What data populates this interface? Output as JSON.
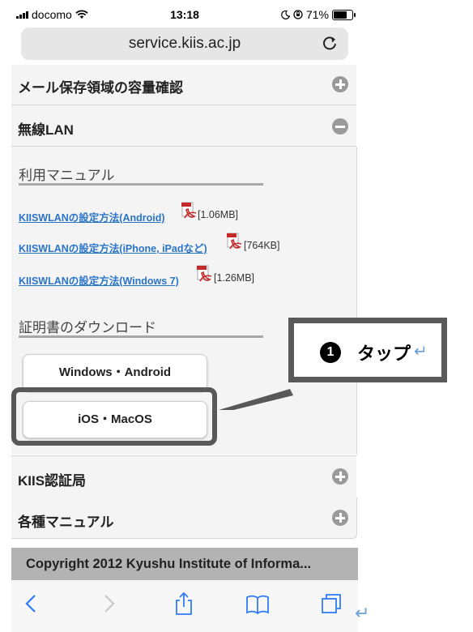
{
  "status_bar": {
    "carrier": "docomo",
    "time": "13:18",
    "battery": "71%"
  },
  "browser": {
    "url": "service.kiis.ac.jp"
  },
  "accordion": {
    "storage": "メール保存領域の容量確認",
    "wireless": "無線LAN",
    "ca": "KIIS認証局",
    "manuals": "各種マニュアル"
  },
  "wlan": {
    "manual_title": "利用マニュアル",
    "files": [
      {
        "label": "KIISWLANの設定方法(Android)",
        "size": "[1.06MB]"
      },
      {
        "label": "KIISWLANの設定方法(iPhone, iPadなど)",
        "size": "[764KB]"
      },
      {
        "label": "KIISWLANの設定方法(Windows 7)",
        "size": "[1.26MB]"
      }
    ],
    "cert_title": "証明書のダウンロード",
    "btn_windows": "Windows・Android",
    "btn_ios": "iOS・MacOS"
  },
  "footer": {
    "copyright": "Copyright 2012 Kyushu Institute of Informa..."
  },
  "callout": {
    "number": "1",
    "text": "タップ",
    "return_mark": "↵"
  },
  "colors": {
    "link": "#2a74c8",
    "callout_border": "#585858",
    "return_mark": "#6aa0d8"
  },
  "icons": [
    "signal-bars-icon",
    "wifi-icon",
    "moon-icon",
    "rotation-lock-icon",
    "battery-icon",
    "reload-icon",
    "plus-circle-icon",
    "minus-circle-icon",
    "pdf-icon",
    "back-icon",
    "forward-icon",
    "share-icon",
    "bookmarks-icon",
    "tabs-icon"
  ]
}
